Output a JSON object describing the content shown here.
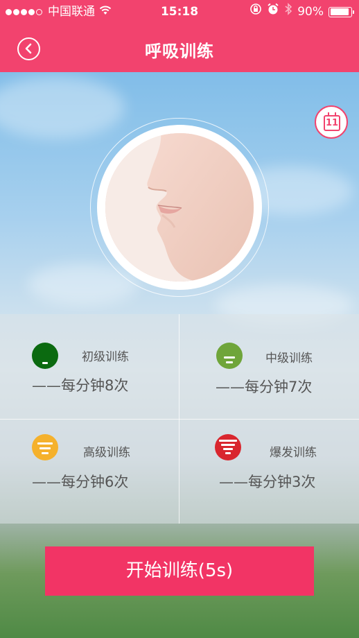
{
  "status_bar": {
    "carrier": "中国联通",
    "time": "15:18",
    "battery_text": "90%",
    "battery_level": 0.9,
    "signal_dots_filled": 4,
    "signal_dots_total": 5
  },
  "nav": {
    "title": "呼吸训练"
  },
  "calendar": {
    "day": "11"
  },
  "levels": [
    {
      "name": "初级训练",
      "rate": "——每分钟8次",
      "color": "#0b6a10"
    },
    {
      "name": "中级训练",
      "rate": "——每分钟7次",
      "color": "#6fa53a"
    },
    {
      "name": "高级训练",
      "rate": "——每分钟6次",
      "color": "#f5b12c"
    },
    {
      "name": "爆发训练",
      "rate": "——每分钟3次",
      "color": "#d9262e"
    }
  ],
  "start_button": {
    "label": "开始训练(5s)"
  },
  "icons": {
    "back": "back-arrow-icon",
    "calendar": "calendar-icon",
    "wifi": "wifi-icon",
    "alarm": "alarm-icon",
    "bluetooth": "bluetooth-icon",
    "rotation_lock": "rotation-lock-icon",
    "battery": "battery-icon"
  },
  "colors": {
    "accent": "#f2436e",
    "button": "#f23465"
  }
}
